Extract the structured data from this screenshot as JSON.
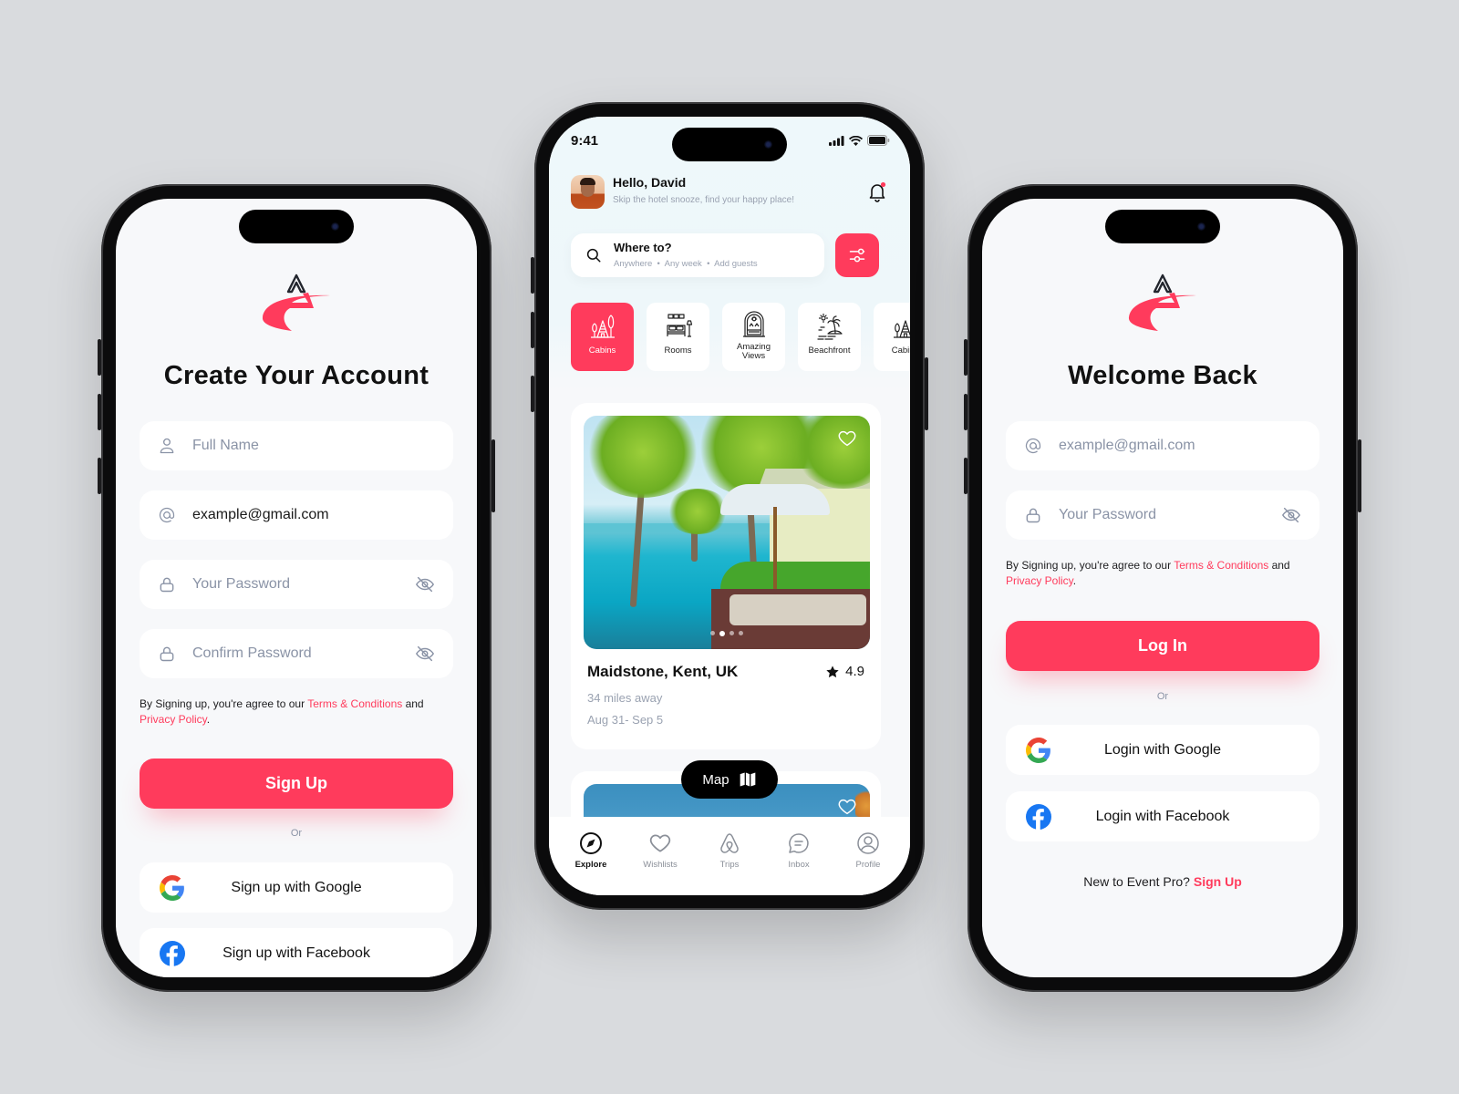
{
  "brand": {
    "accent": "#ff3b5c",
    "text_dark": "#111111",
    "muted": "#8a93a6",
    "background": "#d9dbde"
  },
  "signup": {
    "title": "Create Your Account",
    "fields": [
      {
        "icon": "user-icon",
        "placeholder": "Full Name",
        "value": ""
      },
      {
        "icon": "at-icon",
        "placeholder": "",
        "value": "example@gmail.com"
      },
      {
        "icon": "lock-icon",
        "placeholder": "Your Password",
        "value": "",
        "trailing_icon": "eye-off-icon"
      },
      {
        "icon": "lock-icon",
        "placeholder": "Confirm Password",
        "value": "",
        "trailing_icon": "eye-off-icon"
      }
    ],
    "terms": {
      "prefix": "By Signing up, you're agree to our ",
      "terms_link": "Terms & Conditions",
      "middle": " and ",
      "privacy_link": "Privacy Policy",
      "suffix": "."
    },
    "primary_button": "Sign Up",
    "or_text": "Or",
    "google_button": "Sign up with Google",
    "facebook_button": "Sign up with Facebook"
  },
  "explore": {
    "status": {
      "time": "9:41"
    },
    "greeting": "Hello, David",
    "greeting_sub": "Skip the hotel snooze, find your happy place!",
    "search": {
      "title": "Where to?",
      "sub": "Anywhere  •  Any week  •  Add guests"
    },
    "categories": [
      {
        "label": "Cabins",
        "icon": "cabin-icon",
        "active": true
      },
      {
        "label": "Rooms",
        "icon": "bed-icon",
        "active": false
      },
      {
        "label": "Amazing Views",
        "icon": "window-view-icon",
        "active": false
      },
      {
        "label": "Beachfront",
        "icon": "beach-icon",
        "active": false
      },
      {
        "label": "Cabins",
        "icon": "cabin-icon",
        "active": false
      }
    ],
    "listing": {
      "place": "Maidstone, Kent, UK",
      "rating": "4.9",
      "distance": "34 miles away",
      "dates": "Aug 31- Sep 5",
      "photo_index": 2,
      "photo_count": 4
    },
    "map_button": "Map",
    "tabs": [
      {
        "label": "Explore",
        "icon": "compass-icon",
        "active": true
      },
      {
        "label": "Wishlists",
        "icon": "heart-icon",
        "active": false
      },
      {
        "label": "Trips",
        "icon": "airbnb-icon",
        "active": false
      },
      {
        "label": "Inbox",
        "icon": "chat-icon",
        "active": false
      },
      {
        "label": "Profile",
        "icon": "profile-icon",
        "active": false
      }
    ]
  },
  "login": {
    "title": "Welcome Back",
    "fields": [
      {
        "icon": "at-icon",
        "placeholder": "example@gmail.com",
        "value": ""
      },
      {
        "icon": "lock-icon",
        "placeholder": "Your Password",
        "value": "",
        "trailing_icon": "eye-off-icon"
      }
    ],
    "terms": {
      "prefix": "By Signing up, you're agree to our ",
      "terms_link": "Terms & Conditions",
      "middle": " and ",
      "privacy_link": "Privacy Policy",
      "suffix": "."
    },
    "primary_button": "Log In",
    "or_text": "Or",
    "google_button": "Login with Google",
    "facebook_button": "Login with Facebook",
    "footer": {
      "prefix": "New to Event Pro? ",
      "link": "Sign Up"
    }
  }
}
